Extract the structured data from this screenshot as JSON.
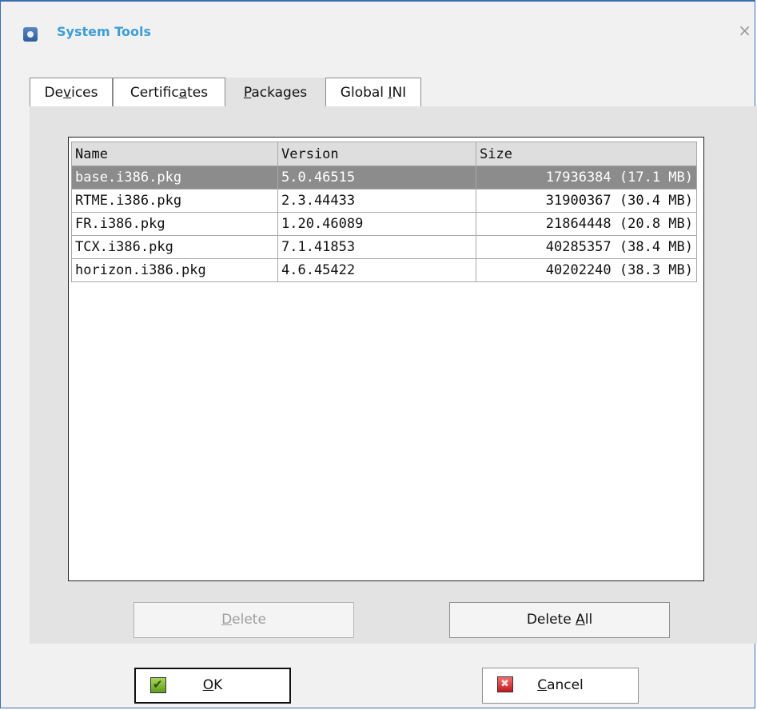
{
  "window": {
    "title": "System Tools",
    "close_symbol": "×"
  },
  "tabs": [
    {
      "pre": "De",
      "key": "v",
      "post": "ices",
      "active": false
    },
    {
      "pre": "Certific",
      "key": "a",
      "post": "tes",
      "active": false
    },
    {
      "pre": "",
      "key": "P",
      "post": "ackages",
      "active": true
    },
    {
      "pre": "Global ",
      "key": "I",
      "post": "NI",
      "active": false
    }
  ],
  "packages": {
    "columns": [
      "Name",
      "Version",
      "Size"
    ],
    "rows": [
      {
        "name": "base.i386.pkg",
        "version": "5.0.46515",
        "size": "17936384 (17.1 MB)",
        "selected": true
      },
      {
        "name": "RTME.i386.pkg",
        "version": "2.3.44433",
        "size": "31900367 (30.4 MB)",
        "selected": false
      },
      {
        "name": "FR.i386.pkg",
        "version": "1.20.46089",
        "size": "21864448 (20.8 MB)",
        "selected": false
      },
      {
        "name": "TCX.i386.pkg",
        "version": "7.1.41853",
        "size": "40285357 (38.4 MB)",
        "selected": false
      },
      {
        "name": "horizon.i386.pkg",
        "version": "4.6.45422",
        "size": "40202240 (38.3 MB)",
        "selected": false
      }
    ]
  },
  "buttons": {
    "delete": {
      "key": "D",
      "post": "elete",
      "enabled": false
    },
    "delete_all": {
      "pre": "Delete ",
      "key": "A",
      "post": "ll"
    },
    "ok": {
      "key": "O",
      "post": "K",
      "icon": "check-icon"
    },
    "cancel": {
      "key": "C",
      "post": "ancel",
      "icon": "cancel-x-icon"
    }
  },
  "colors": {
    "title": "#3e9ed6",
    "selected_row": "#8c8c8c",
    "panel": "#e3e3e3",
    "window_border": "#3b6fb0"
  }
}
